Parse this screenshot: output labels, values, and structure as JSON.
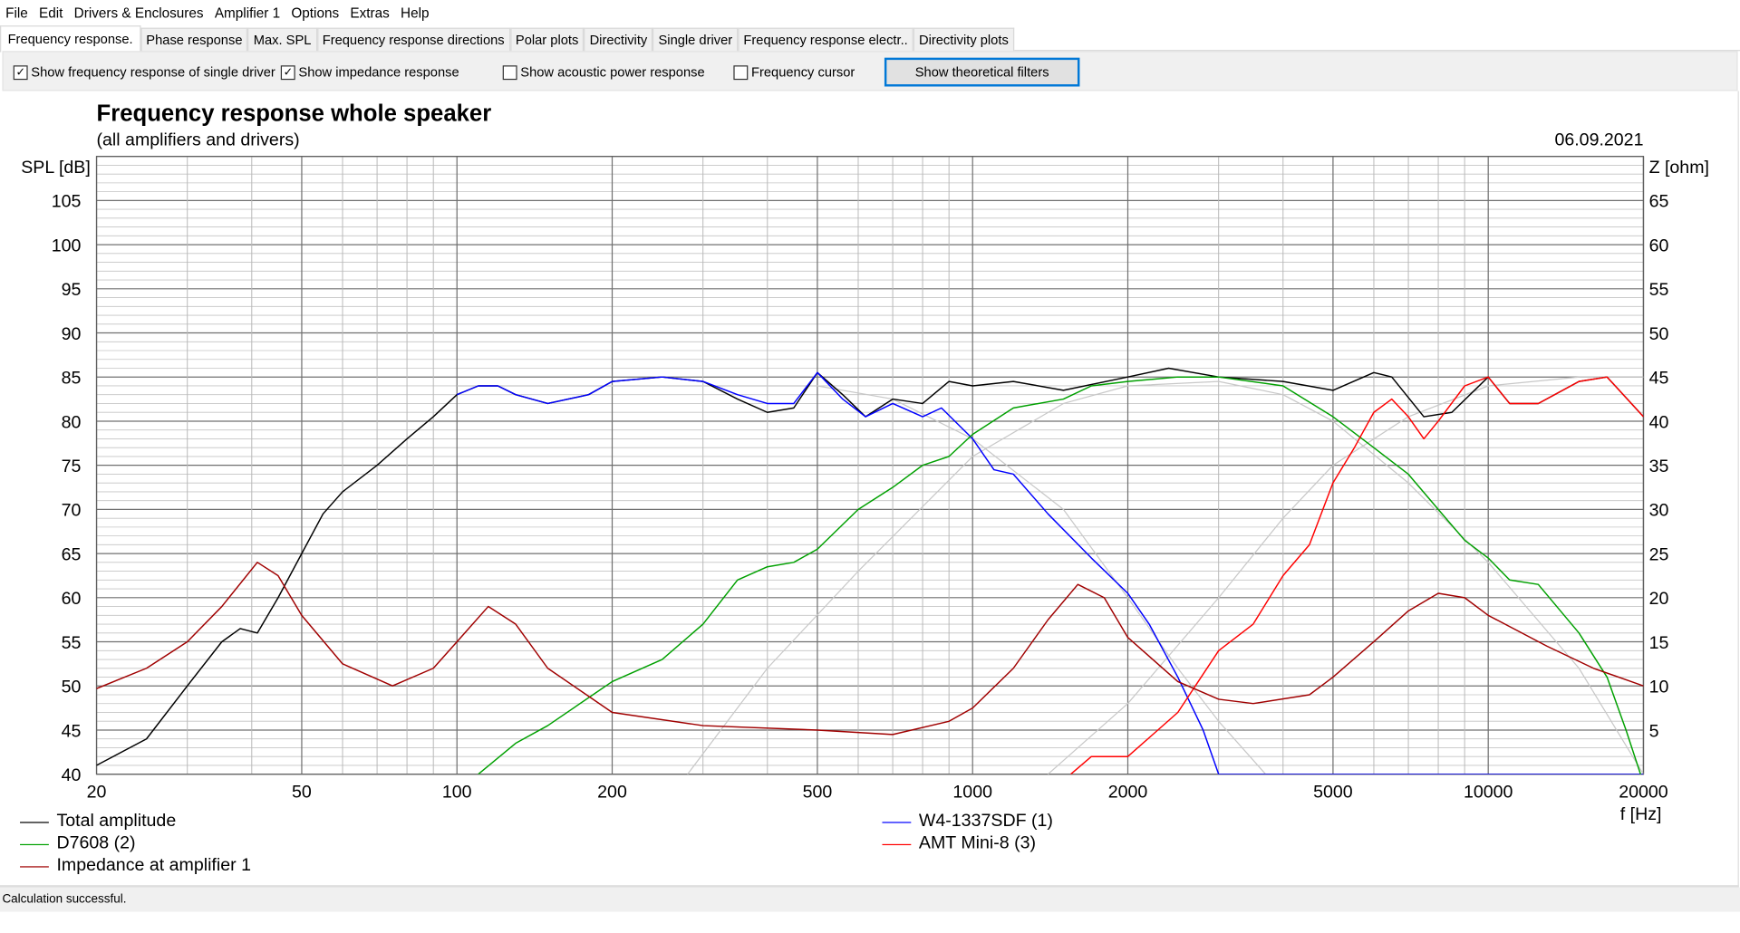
{
  "menu": [
    "File",
    "Edit",
    "Drivers & Enclosures",
    "Amplifier 1",
    "Options",
    "Extras",
    "Help"
  ],
  "tabs": [
    "Frequency response.",
    "Phase response",
    "Max. SPL",
    "Frequency response directions",
    "Polar plots",
    "Directivity",
    "Single driver",
    "Frequency response electr..",
    "Directivity plots"
  ],
  "active_tab": 0,
  "options": {
    "single_driver": {
      "label": "Show frequency response of single driver",
      "checked": true
    },
    "impedance": {
      "label": "Show impedance response",
      "checked": true
    },
    "acoustic_power": {
      "label": "Show acoustic power response",
      "checked": false
    },
    "freq_cursor": {
      "label": "Frequency cursor",
      "checked": false
    },
    "theoretical_button": "Show theoretical filters"
  },
  "status": "Calculation successful.",
  "colors": {
    "total": "#000000",
    "woofer": "#0000ff",
    "mid": "#00a000",
    "tweeter": "#ff0000",
    "impedance": "#a00000",
    "theory": "#c8c8c8"
  },
  "chart_data": {
    "type": "line",
    "title": "Frequency response whole speaker",
    "subtitle": "(all amplifiers and drivers)",
    "date": "06.09.2021",
    "ylabel": "SPL [dB]",
    "y2label": "Z [ohm]",
    "xlabel": "f [Hz]",
    "xscale": "log",
    "xlim": [
      20,
      20000
    ],
    "ylim": [
      40,
      110
    ],
    "y2lim": [
      0,
      70
    ],
    "xticks": [
      20,
      50,
      100,
      200,
      500,
      1000,
      2000,
      5000,
      10000,
      20000
    ],
    "yticks": [
      40,
      45,
      50,
      55,
      60,
      65,
      70,
      75,
      80,
      85,
      90,
      95,
      100,
      105
    ],
    "y2ticks": [
      5,
      10,
      15,
      20,
      25,
      30,
      35,
      40,
      45,
      50,
      55,
      60,
      65
    ],
    "grid": true,
    "legend_position": "bottom",
    "series": [
      {
        "name": "Total amplitude",
        "color": "#000000",
        "axis": "left",
        "x": [
          20,
          25,
          30,
          35,
          38,
          41,
          45,
          50,
          55,
          60,
          70,
          80,
          90,
          100,
          110,
          120,
          130,
          150,
          180,
          200,
          250,
          300,
          350,
          400,
          450,
          500,
          560,
          620,
          700,
          800,
          900,
          1000,
          1200,
          1500,
          2000,
          2400,
          3000,
          4000,
          5000,
          6000,
          6500,
          7500,
          8500,
          10000,
          11000,
          12500,
          15000,
          17000,
          20000
        ],
        "y": [
          41,
          44,
          50,
          55,
          56.5,
          56,
          60,
          65,
          69.5,
          72,
          75,
          78,
          80.5,
          83,
          84,
          84,
          83,
          82,
          83,
          84.5,
          85,
          84.5,
          82.5,
          81,
          81.5,
          85.5,
          83,
          80.5,
          82.5,
          82,
          84.5,
          84,
          84.5,
          83.5,
          85,
          86,
          85,
          84.5,
          83.5,
          85.5,
          85,
          80.5,
          81,
          85,
          82,
          82,
          84.5,
          85,
          80.5
        ]
      },
      {
        "name": "W4-1337SDF (1)",
        "color": "#0000ff",
        "axis": "left",
        "x": [
          100,
          110,
          120,
          130,
          150,
          180,
          200,
          250,
          300,
          350,
          400,
          450,
          500,
          560,
          620,
          700,
          800,
          870,
          1000,
          1100,
          1200,
          1400,
          1700,
          2000,
          2200,
          2500,
          2800,
          3000,
          20000
        ],
        "y": [
          83,
          84,
          84,
          83,
          82,
          83,
          84.5,
          85,
          84.5,
          83,
          82,
          82,
          85.5,
          82.5,
          80.5,
          82,
          80.5,
          81.5,
          78,
          74.5,
          74,
          69.5,
          64.5,
          60.5,
          57,
          51,
          45,
          40,
          40
        ]
      },
      {
        "name": "D7608 (2)",
        "color": "#00a000",
        "axis": "left",
        "x": [
          110,
          130,
          150,
          200,
          250,
          300,
          350,
          400,
          450,
          500,
          600,
          700,
          800,
          900,
          1000,
          1200,
          1500,
          1700,
          2000,
          2500,
          3000,
          4000,
          5000,
          6000,
          7000,
          8000,
          9000,
          10000,
          11000,
          12500,
          15000,
          17000,
          18500,
          20000
        ],
        "y": [
          40,
          43.5,
          45.5,
          50.5,
          53,
          57,
          62,
          63.5,
          64,
          65.5,
          70,
          72.5,
          75,
          76,
          78.5,
          81.5,
          82.5,
          84,
          84.5,
          85,
          85,
          84,
          80.5,
          77,
          74,
          70,
          66.5,
          64.5,
          62,
          61.5,
          56,
          51,
          45,
          39
        ]
      },
      {
        "name": "AMT Mini-8 (3)",
        "color": "#ff0000",
        "axis": "left",
        "x": [
          1550,
          1700,
          2000,
          2500,
          3000,
          3500,
          4000,
          4500,
          5000,
          5500,
          6000,
          6500,
          7000,
          7500,
          8000,
          9000,
          10000,
          11000,
          12500,
          15000,
          17000,
          20000
        ],
        "y": [
          40,
          42,
          42,
          47,
          54,
          57,
          62.5,
          66,
          73,
          77,
          81,
          82.5,
          80.5,
          78,
          80,
          84,
          85,
          82,
          82,
          84.5,
          85,
          80.5
        ]
      },
      {
        "name": "Impedance at amplifier 1",
        "color": "#a00000",
        "axis": "right",
        "x": [
          20,
          25,
          30,
          35,
          41,
          45,
          50,
          60,
          75,
          90,
          100,
          115,
          130,
          150,
          200,
          300,
          500,
          700,
          900,
          1000,
          1200,
          1400,
          1600,
          1800,
          2000,
          2500,
          3000,
          3500,
          4500,
          5000,
          6000,
          7000,
          8000,
          9000,
          10000,
          13000,
          16000,
          20000
        ],
        "y": [
          9.7,
          12,
          15,
          19,
          24,
          22.5,
          18,
          12.5,
          10,
          12,
          15,
          19,
          17,
          12,
          7,
          5.5,
          5,
          4.5,
          6,
          7.5,
          12,
          17.5,
          21.5,
          20,
          15.5,
          10.5,
          8.5,
          8,
          9,
          11,
          15,
          18.5,
          20.5,
          20,
          18,
          14.5,
          12,
          10
        ]
      },
      {
        "name": "theoretical lowpass",
        "color": "#c8c8c8",
        "axis": "left",
        "unlabeled": true,
        "x": [
          100,
          300,
          500,
          700,
          1000,
          1500,
          2000,
          2500,
          3000,
          3700
        ],
        "y": [
          84,
          84,
          84,
          82.5,
          78,
          70,
          60,
          52,
          46,
          40
        ]
      },
      {
        "name": "theoretical bandpass",
        "color": "#c8c8c8",
        "axis": "left",
        "unlabeled": true,
        "x": [
          280,
          400,
          600,
          1000,
          1500,
          2000,
          3000,
          4000,
          5000,
          7000,
          10000,
          15000,
          20000
        ],
        "y": [
          40,
          52,
          63,
          76,
          82,
          84,
          84.5,
          83,
          80,
          73,
          64,
          52,
          40
        ]
      },
      {
        "name": "theoretical highpass",
        "color": "#c8c8c8",
        "axis": "left",
        "unlabeled": true,
        "x": [
          1400,
          2000,
          3000,
          4000,
          5000,
          7000,
          10000,
          15000,
          20000
        ],
        "y": [
          40,
          48,
          60,
          69,
          75,
          80.5,
          84,
          85,
          85
        ]
      }
    ]
  }
}
